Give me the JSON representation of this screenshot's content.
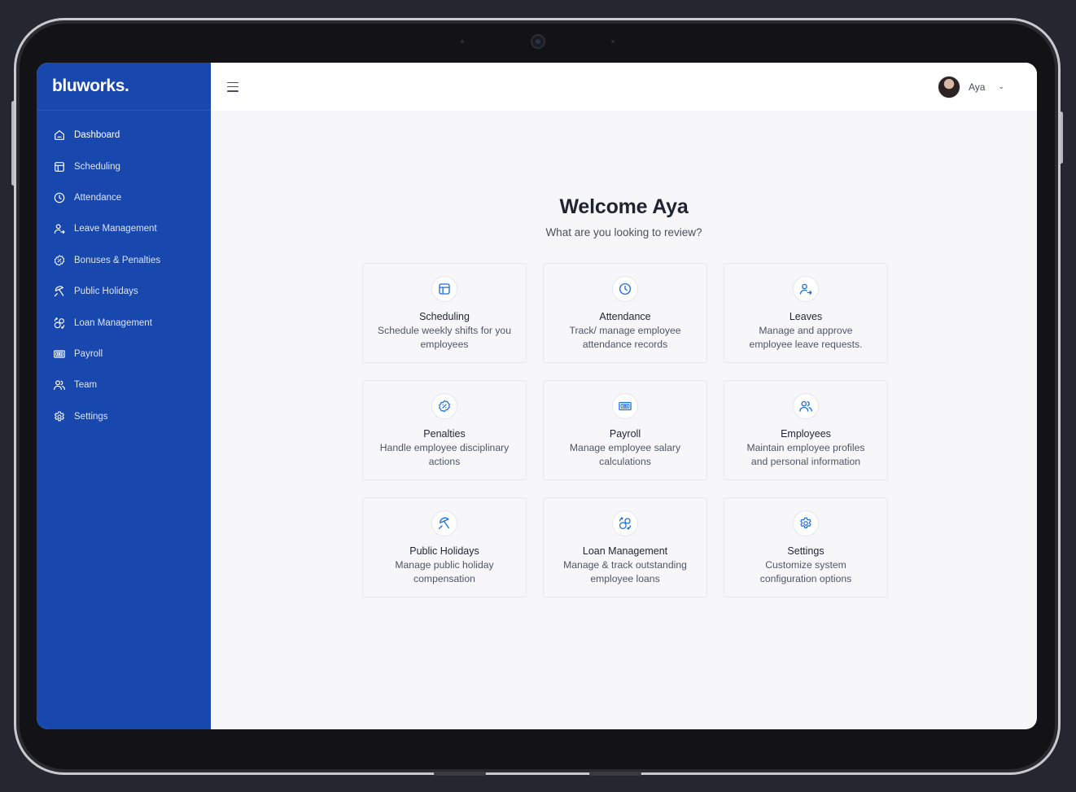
{
  "brand": {
    "logo_text": "bluworks."
  },
  "sidebar": {
    "items": [
      {
        "label": "Dashboard",
        "icon": "home-icon"
      },
      {
        "label": "Scheduling",
        "icon": "calendar-grid-icon"
      },
      {
        "label": "Attendance",
        "icon": "clock-icon"
      },
      {
        "label": "Leave Management",
        "icon": "user-arrow-icon"
      },
      {
        "label": "Bonuses & Penalties",
        "icon": "percent-badge-icon"
      },
      {
        "label": "Public Holidays",
        "icon": "umbrella-icon"
      },
      {
        "label": "Loan Management",
        "icon": "coin-exchange-icon"
      },
      {
        "label": "Payroll",
        "icon": "banknote-icon"
      },
      {
        "label": "Team",
        "icon": "users-icon"
      },
      {
        "label": "Settings",
        "icon": "gear-icon"
      }
    ]
  },
  "header": {
    "user_name": "Aya",
    "chevron": "⌄"
  },
  "welcome": {
    "title": "Welcome Aya",
    "subtitle": "What are you looking to review?"
  },
  "cards": [
    {
      "title": "Scheduling",
      "desc": "Schedule weekly shifts for you employees",
      "icon": "calendar-grid-icon"
    },
    {
      "title": "Attendance",
      "desc": "Track/ manage employee attendance records",
      "icon": "clock-icon"
    },
    {
      "title": "Leaves",
      "desc": "Manage and approve employee leave requests.",
      "icon": "user-arrow-icon"
    },
    {
      "title": "Penalties",
      "desc": "Handle employee disciplinary actions",
      "icon": "percent-badge-icon"
    },
    {
      "title": "Payroll",
      "desc": "Manage employee salary calculations",
      "icon": "banknote-icon"
    },
    {
      "title": "Employees",
      "desc": "Maintain employee profiles and personal information",
      "icon": "users-icon"
    },
    {
      "title": "Public Holidays",
      "desc": "Manage public holiday compensation",
      "icon": "umbrella-icon"
    },
    {
      "title": "Loan Management",
      "desc": "Manage & track outstanding employee loans",
      "icon": "coin-exchange-icon"
    },
    {
      "title": "Settings",
      "desc": "Customize system configuration options",
      "icon": "gear-icon"
    }
  ],
  "colors": {
    "sidebar": "#1848ad",
    "accent": "#1c6fd9",
    "background": "#f7f7f9"
  }
}
